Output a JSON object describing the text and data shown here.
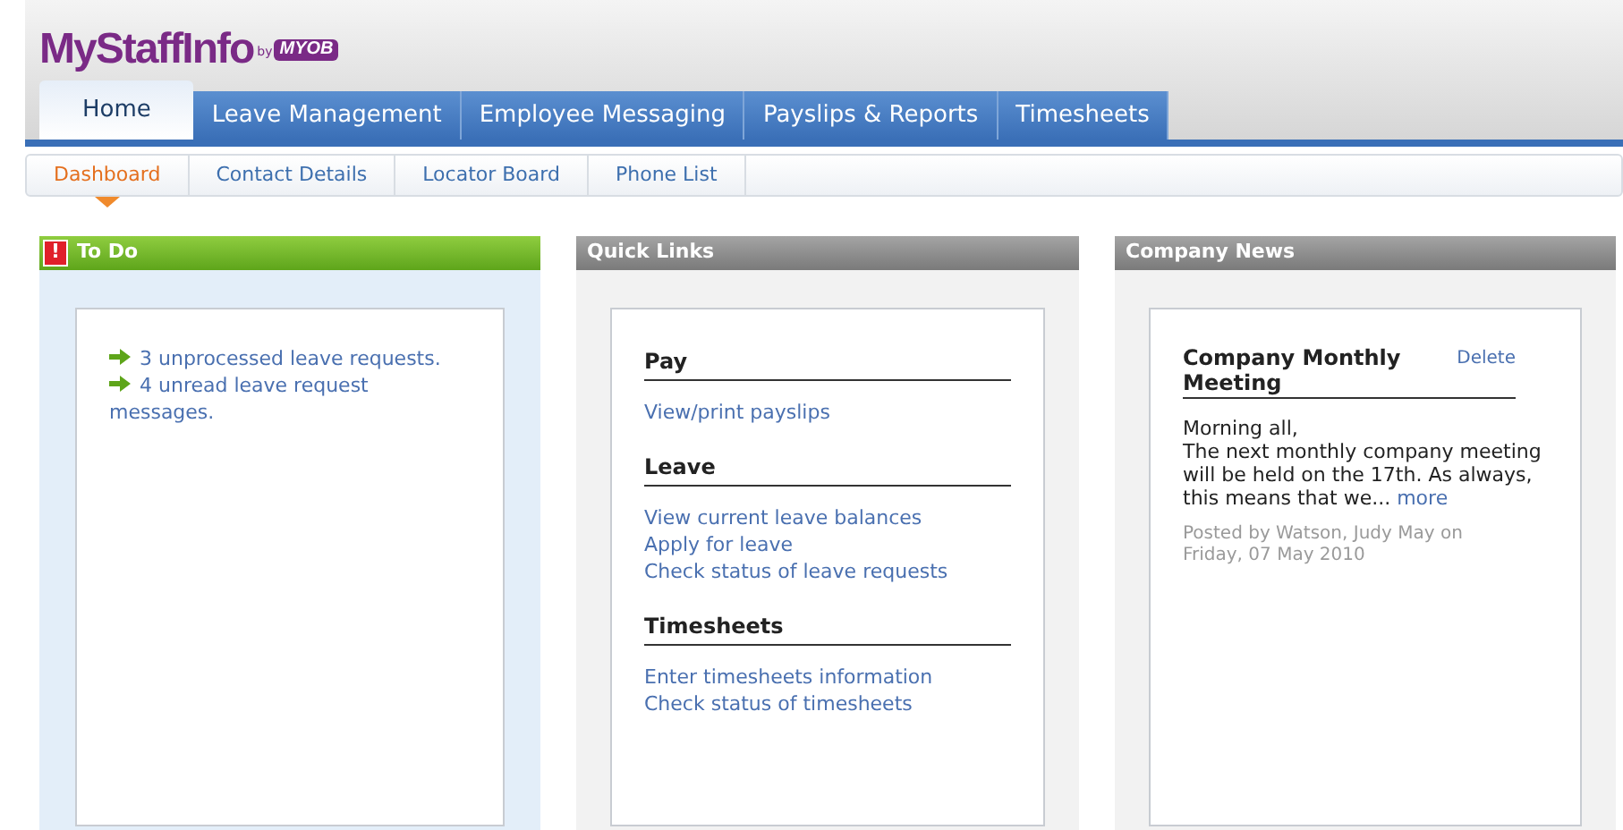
{
  "logo": {
    "name": "MyStaffInfo",
    "by": "by",
    "brand": "MYOB"
  },
  "tabs": [
    {
      "label": "Home",
      "selected": true
    },
    {
      "label": "Leave Management",
      "selected": false
    },
    {
      "label": "Employee Messaging",
      "selected": false
    },
    {
      "label": "Payslips & Reports",
      "selected": false
    },
    {
      "label": "Timesheets",
      "selected": false
    }
  ],
  "subnav": [
    {
      "label": "Dashboard",
      "selected": true
    },
    {
      "label": "Contact Details",
      "selected": false
    },
    {
      "label": "Locator Board",
      "selected": false
    },
    {
      "label": "Phone List",
      "selected": false
    }
  ],
  "todo": {
    "title": "To Do",
    "alert": "!",
    "items": [
      "3 unprocessed leave requests.",
      "4 unread leave request messages."
    ]
  },
  "quick_links": {
    "title": "Quick Links",
    "sections": [
      {
        "heading": "Pay",
        "links": [
          "View/print payslips"
        ]
      },
      {
        "heading": "Leave",
        "links": [
          "View current leave balances",
          "Apply for leave",
          "Check status of leave requests"
        ]
      },
      {
        "heading": "Timesheets",
        "links": [
          "Enter timesheets information",
          "Check status of timesheets"
        ]
      }
    ]
  },
  "company_news": {
    "title": "Company News",
    "article": {
      "title": "Company Monthly Meeting",
      "delete": "Delete",
      "greeting": "Morning all,",
      "body": "The next monthly company meeting will be held on the 17th. As always, this means that we...",
      "more": "more",
      "posted": "Posted by Watson, Judy May on Friday, 07 May 2010"
    }
  }
}
